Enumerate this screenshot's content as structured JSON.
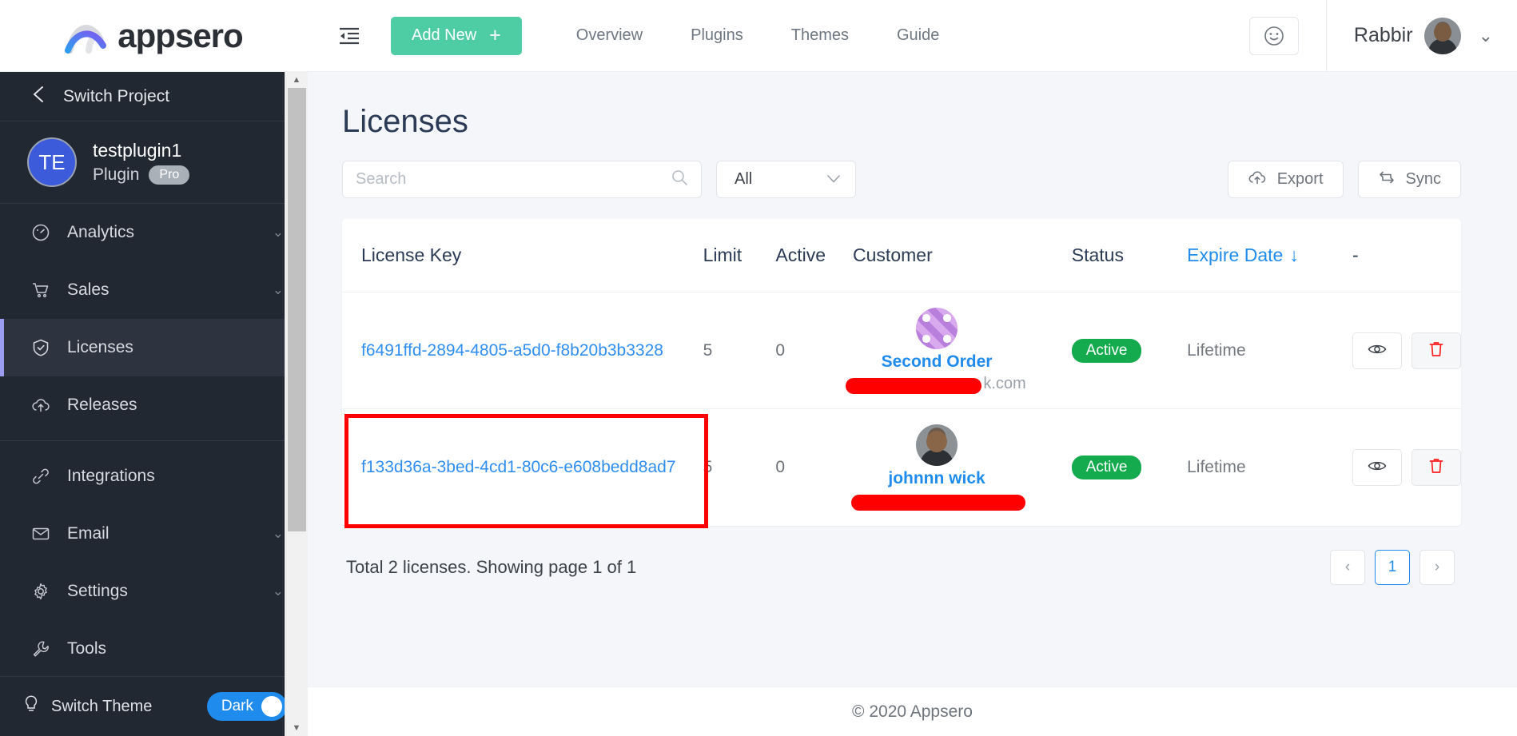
{
  "brand": {
    "name": "appsero"
  },
  "topbar": {
    "collapse_icon": "sidebar-collapse-icon",
    "add_new_label": "Add New",
    "add_new_plus": "+",
    "nav": [
      {
        "label": "Overview"
      },
      {
        "label": "Plugins"
      },
      {
        "label": "Themes"
      },
      {
        "label": "Guide"
      }
    ],
    "smiley_icon": "smiley-icon",
    "user_name": "Rabbir",
    "user_chevron": "⌄"
  },
  "sidebar": {
    "switch_project_label": "Switch Project",
    "back_icon": "chevron-left-icon",
    "project": {
      "initials": "TE",
      "name": "testplugin1",
      "type": "Plugin",
      "badge": "Pro"
    },
    "items": [
      {
        "label": "Analytics",
        "icon": "gauge-icon",
        "chevron": "⌄",
        "active": false
      },
      {
        "label": "Sales",
        "icon": "cart-icon",
        "chevron": "⌄",
        "active": false
      },
      {
        "label": "Licenses",
        "icon": "shield-check-icon",
        "chevron": "",
        "active": true
      },
      {
        "label": "Releases",
        "icon": "cloud-upload-icon",
        "chevron": "",
        "active": false
      },
      {
        "label": "Integrations",
        "icon": "link-icon",
        "chevron": "",
        "active": false
      },
      {
        "label": "Email",
        "icon": "envelope-icon",
        "chevron": "⌄",
        "active": false
      },
      {
        "label": "Settings",
        "icon": "gear-icon",
        "chevron": "⌄",
        "active": false
      },
      {
        "label": "Tools",
        "icon": "wrench-icon",
        "chevron": "",
        "active": false
      }
    ],
    "switch_theme": {
      "label": "Switch Theme",
      "icon": "lightbulb-icon",
      "toggle_label": "Dark"
    }
  },
  "main": {
    "page_title": "Licenses",
    "search": {
      "placeholder": "Search",
      "value": "",
      "icon": "search-icon"
    },
    "filter": {
      "selected": "All",
      "chevron": "⌄"
    },
    "export_button": {
      "label": "Export",
      "icon": "cloud-upload-icon"
    },
    "sync_button": {
      "label": "Sync",
      "icon": "sync-icon"
    },
    "table": {
      "columns": [
        {
          "label": "License Key",
          "sorted": false
        },
        {
          "label": "Limit",
          "sorted": false
        },
        {
          "label": "Active",
          "sorted": false
        },
        {
          "label": "Customer",
          "sorted": false
        },
        {
          "label": "Status",
          "sorted": false
        },
        {
          "label": "Expire Date",
          "sorted": true,
          "arrow": "↓"
        },
        {
          "label": "-",
          "sorted": false
        }
      ],
      "rows": [
        {
          "license_key": "f6491ffd-2894-4805-a5d0-f8b20b3b3328",
          "limit": "5",
          "active": "0",
          "customer_name": "Second Order",
          "customer_email_visible": "k.com",
          "avatar_style": "pattern",
          "status": "Active",
          "expire_date": "Lifetime",
          "view_icon": "eye-icon",
          "delete_icon": "trash-icon",
          "highlighted": false
        },
        {
          "license_key": "f133d36a-3bed-4cd1-80c6-e608bedd8ad7",
          "limit": "5",
          "active": "0",
          "customer_name": "johnnn wick",
          "customer_email_visible": "",
          "avatar_style": "photo",
          "status": "Active",
          "expire_date": "Lifetime",
          "view_icon": "eye-icon",
          "delete_icon": "trash-icon",
          "highlighted": true
        }
      ]
    },
    "pagination": {
      "summary": "Total 2 licenses. Showing page 1 of 1",
      "prev": "‹",
      "pages": [
        "1"
      ],
      "next": "›",
      "current": "1"
    }
  },
  "footer": {
    "copyright": "© 2020 Appsero"
  },
  "colors": {
    "accent_green": "#4ecda4",
    "link_blue": "#1f8ced",
    "status_green": "#14ab4f",
    "sidebar_bg": "#222831",
    "active_marker": "#9b9ef0",
    "danger_red": "#fe0000"
  }
}
